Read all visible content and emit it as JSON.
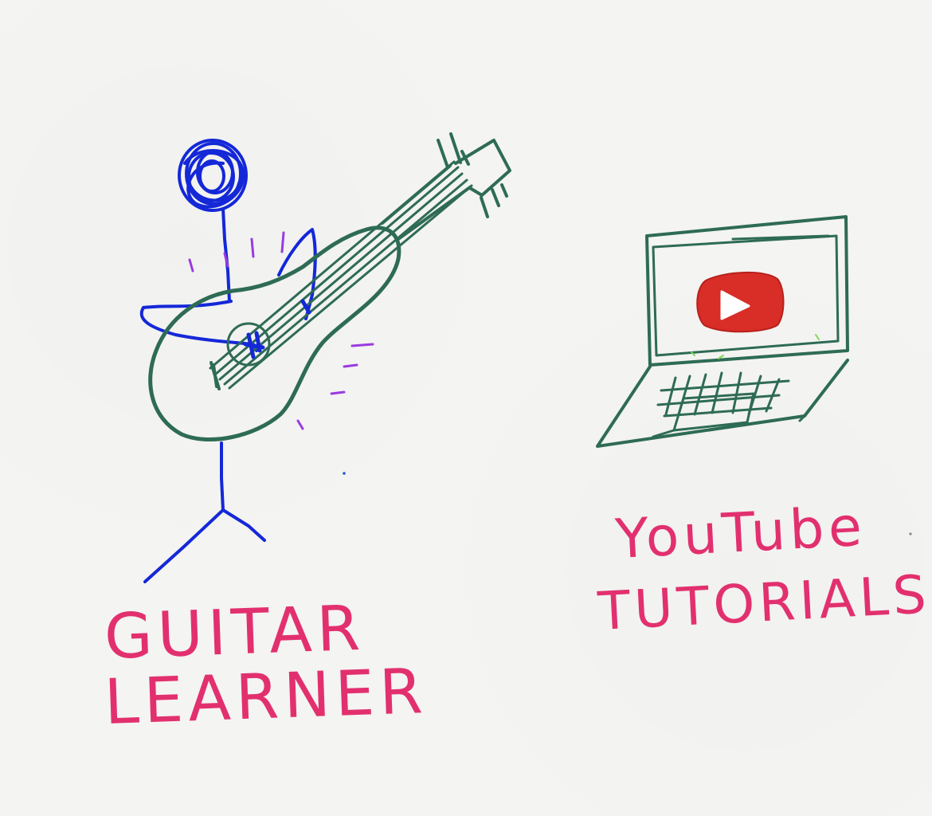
{
  "figures": {
    "learner": {
      "label_line1": "GUITAR",
      "label_line2": "LEARNER"
    },
    "tutorials": {
      "label_line1": "YouTube",
      "label_line2": "TUTORIALS"
    }
  },
  "colors": {
    "paper": "#f4f4f2",
    "person_ink": "#1428d8",
    "guitar_ink": "#2e6b55",
    "label_ink": "#e2306f",
    "motion_marks": "#9a3be0",
    "play_button": "#d92d27",
    "sparkle": "#7ed957"
  },
  "icons": {
    "play_button": "youtube-play-icon"
  }
}
